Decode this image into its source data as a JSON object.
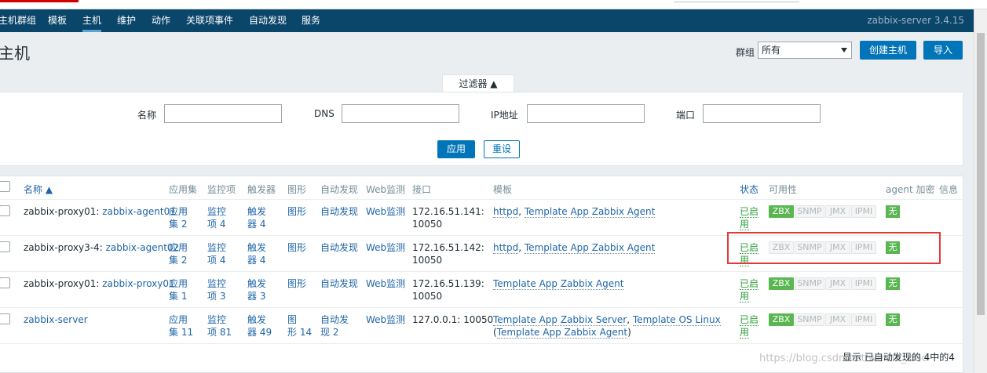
{
  "nav": {
    "items": [
      "主机群组",
      "模板",
      "主机",
      "维护",
      "动作",
      "关联项事件",
      "自动发现",
      "服务"
    ],
    "active_index": 2,
    "server_name": "zabbix-server 3.4.15"
  },
  "page": {
    "title": "主机",
    "group_label": "群组",
    "group_value": "所有",
    "create_button": "创建主机",
    "import_button": "导入"
  },
  "filter": {
    "tab_label": "过滤器 ▲",
    "name_label": "名称",
    "dns_label": "DNS",
    "ip_label": "IP地址",
    "port_label": "端口",
    "apply_button": "应用",
    "reset_button": "重设"
  },
  "table": {
    "headers": {
      "name": "名称 ▲",
      "apps": "应用集",
      "items": "监控项",
      "triggers": "触发器",
      "graphs": "图形",
      "discovery": "自动发现",
      "web": "Web监测",
      "interface": "接口",
      "templates": "模板",
      "status": "状态",
      "availability": "可用性",
      "encryption": "agent 加密",
      "info": "信息"
    },
    "rows": [
      {
        "prefix": "zabbix-proxy01: ",
        "host": "zabbix-agent01",
        "apps": [
          "应用",
          "集 2"
        ],
        "items": [
          "监控",
          "项 4"
        ],
        "triggers": [
          "触发",
          "器 4"
        ],
        "graphs": [
          "图形",
          ""
        ],
        "discovery": [
          "自动发现",
          ""
        ],
        "web": "Web监测",
        "interface": [
          "172.16.51.141:",
          "10050"
        ],
        "templates": [
          "httpd",
          ", ",
          "Template App Zabbix Agent",
          "",
          ""
        ],
        "status": [
          "已启",
          "用"
        ],
        "zbx_on": true,
        "enc": "无"
      },
      {
        "prefix": "zabbix-proxy3-4: ",
        "host": "zabbix-agent02",
        "apps": [
          "应用",
          "集 2"
        ],
        "items": [
          "监控",
          "项 4"
        ],
        "triggers": [
          "触发",
          "器 4"
        ],
        "graphs": [
          "图形",
          ""
        ],
        "discovery": [
          "自动发现",
          ""
        ],
        "web": "Web监测",
        "interface": [
          "172.16.51.142:",
          "10050"
        ],
        "templates": [
          "httpd",
          ", ",
          "Template App Zabbix Agent",
          "",
          ""
        ],
        "status": [
          "已启",
          "用"
        ],
        "zbx_on": false,
        "enc": "无"
      },
      {
        "prefix": "zabbix-proxy01: ",
        "host": "zabbix-proxy01",
        "apps": [
          "应用",
          "集 1"
        ],
        "items": [
          "监控",
          "项 3"
        ],
        "triggers": [
          "触发",
          "器 3"
        ],
        "graphs": [
          "图形",
          ""
        ],
        "discovery": [
          "自动发现",
          ""
        ],
        "web": "Web监测",
        "interface": [
          "172.16.51.139:",
          "10050"
        ],
        "templates": [
          "Template App Zabbix Agent",
          "",
          "",
          "",
          ""
        ],
        "status": [
          "已启",
          "用"
        ],
        "zbx_on": true,
        "enc": "无"
      },
      {
        "prefix": "",
        "host": "zabbix-server",
        "apps": [
          "应用",
          "集 11"
        ],
        "items": [
          "监控",
          "项 81"
        ],
        "triggers": [
          "触发",
          "器 49"
        ],
        "graphs": [
          "图",
          "形 14"
        ],
        "discovery": [
          "自动发",
          "现 2"
        ],
        "web": "Web监测",
        "interface": [
          "127.0.0.1: 10050",
          ""
        ],
        "templates": [
          "Template App Zabbix Server",
          ", ",
          "Template OS Linux",
          "(",
          "Template App Zabbix Agent",
          ")"
        ],
        "status": [
          "已启",
          "用"
        ],
        "zbx_on": true,
        "enc": "无"
      }
    ],
    "avail_labels": [
      "ZBX",
      "SNMP",
      "JMX",
      "IPMI"
    ],
    "footer": "显示 已自动发现的 4中的4"
  },
  "watermark": "https://blog.csdn.net/weixin_xiao",
  "colors": {
    "nav_bg": "#0a466a",
    "link": "#1f65a6",
    "green": "#2f9f3b",
    "badge_green": "#59b752",
    "primary": "#0275b8",
    "highlight": "#e03b3b"
  }
}
